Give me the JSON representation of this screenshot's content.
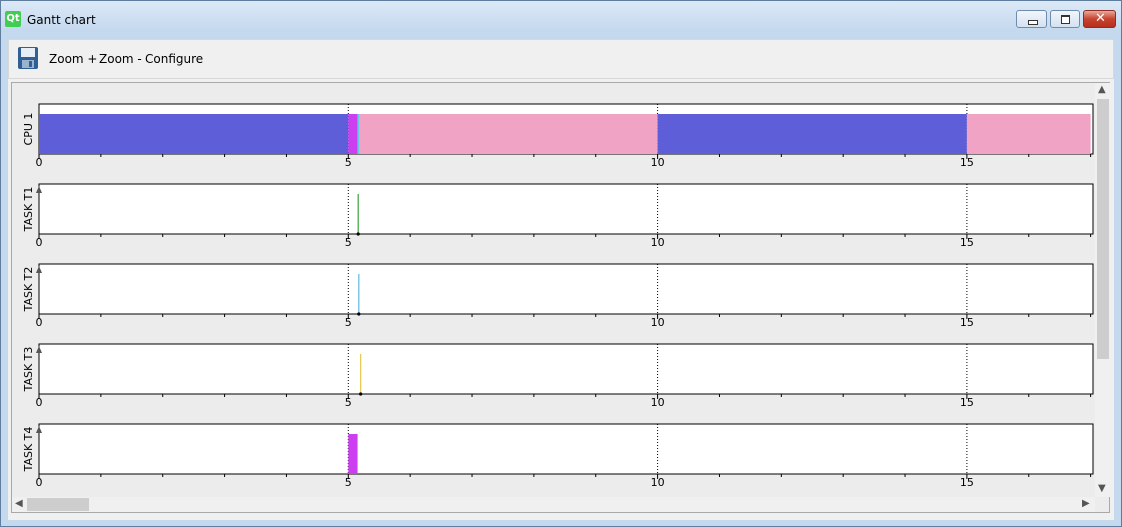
{
  "window": {
    "title": "Gantt chart"
  },
  "toolbar": {
    "zoom_in_label": "Zoom +",
    "zoom_out_label": "Zoom -",
    "configure_label": "Configure"
  },
  "axis": {
    "ticks": [
      "0",
      "5",
      "10",
      "15"
    ]
  },
  "rows": [
    {
      "label": "CPU 1",
      "type": "cpu"
    },
    {
      "label": "TASK T1",
      "type": "task"
    },
    {
      "label": "TASK T2",
      "type": "task"
    },
    {
      "label": "TASK T3",
      "type": "task"
    },
    {
      "label": "TASK T4",
      "type": "task"
    }
  ],
  "chart_data": {
    "type": "gantt",
    "x_range": [
      0,
      17
    ],
    "series": [
      {
        "name": "CPU 1",
        "segments": [
          {
            "start": 0,
            "end": 5,
            "color": "#5e5fd8"
          },
          {
            "start": 5,
            "end": 5.15,
            "color": "#cc3ff0"
          },
          {
            "start": 5.15,
            "end": 5.18,
            "color": "#5fd0df"
          },
          {
            "start": 5.18,
            "end": 10,
            "color": "#f0a3c5"
          },
          {
            "start": 10,
            "end": 15,
            "color": "#5e5fd8"
          },
          {
            "start": 15,
            "end": 17,
            "color": "#f0a3c5"
          }
        ]
      },
      {
        "name": "TASK T1",
        "events": [
          {
            "at": 5.16,
            "color": "#3aa13a"
          }
        ]
      },
      {
        "name": "TASK T2",
        "events": [
          {
            "at": 5.17,
            "color": "#5fb8e0"
          }
        ]
      },
      {
        "name": "TASK T3",
        "events": [
          {
            "at": 5.2,
            "color": "#e8c64a"
          }
        ]
      },
      {
        "name": "TASK T4",
        "segments": [
          {
            "start": 5,
            "end": 5.15,
            "color": "#cc3ff0"
          }
        ]
      }
    ]
  },
  "colors": {
    "titlebar": "#c4d8ee",
    "pane": "#ececec"
  }
}
